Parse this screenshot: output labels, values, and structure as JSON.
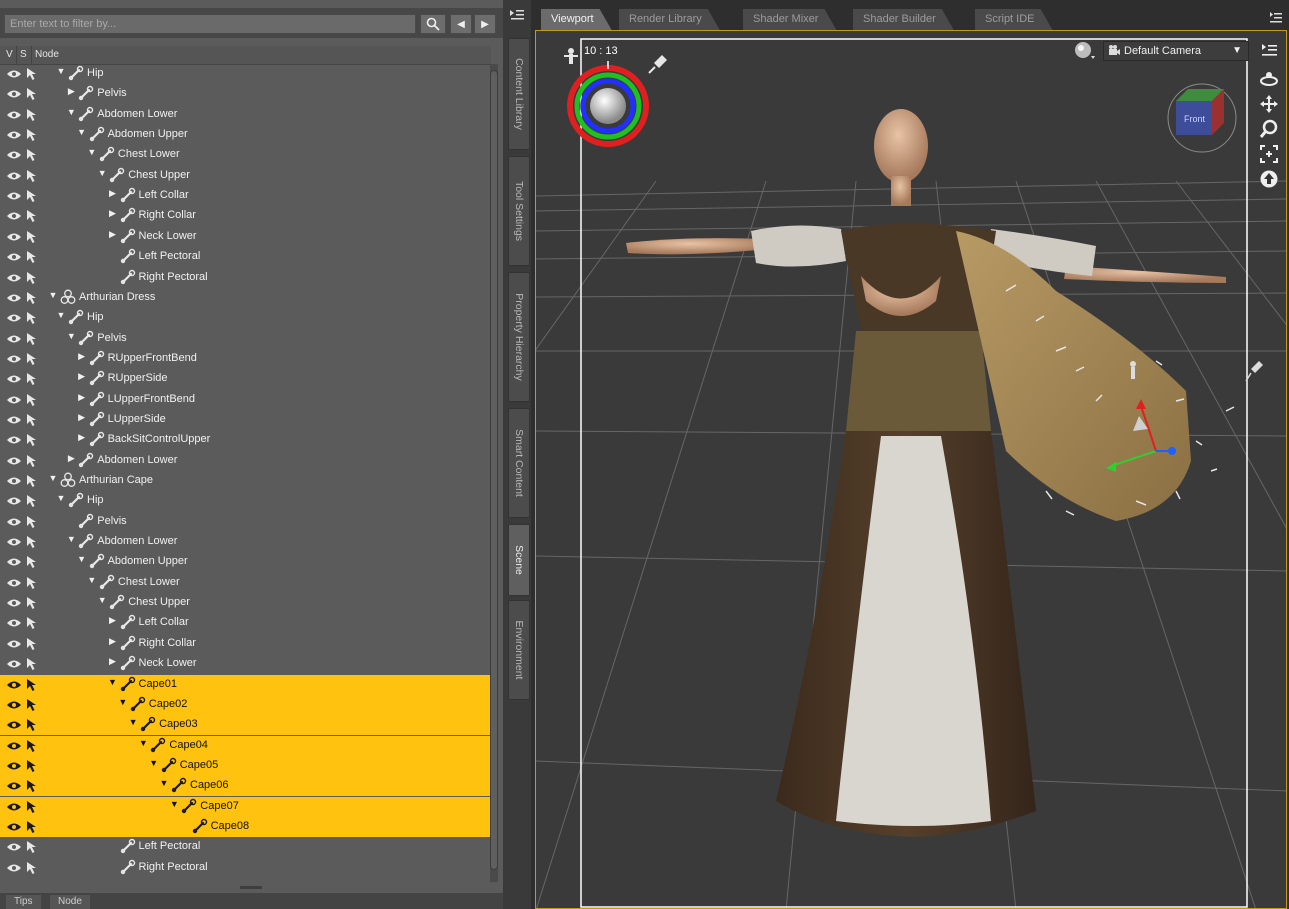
{
  "filter": {
    "placeholder": "Enter text to filter by..."
  },
  "tree_header": {
    "v": "V",
    "s": "S",
    "node": "Node"
  },
  "tree_rows": [
    {
      "label": "Hip",
      "indent": 0,
      "exp": "down",
      "icon": "bone",
      "selected": false
    },
    {
      "label": "Pelvis",
      "indent": 1,
      "exp": "right",
      "icon": "bone",
      "selected": false
    },
    {
      "label": "Abdomen Lower",
      "indent": 1,
      "exp": "down",
      "icon": "bone",
      "selected": false
    },
    {
      "label": "Abdomen Upper",
      "indent": 2,
      "exp": "down",
      "icon": "bone",
      "selected": false
    },
    {
      "label": "Chest Lower",
      "indent": 3,
      "exp": "down",
      "icon": "bone",
      "selected": false
    },
    {
      "label": "Chest Upper",
      "indent": 4,
      "exp": "down",
      "icon": "bone",
      "selected": false
    },
    {
      "label": "Left Collar",
      "indent": 5,
      "exp": "right",
      "icon": "bone",
      "selected": false
    },
    {
      "label": "Right Collar",
      "indent": 5,
      "exp": "right",
      "icon": "bone",
      "selected": false
    },
    {
      "label": "Neck Lower",
      "indent": 5,
      "exp": "right",
      "icon": "bone",
      "selected": false
    },
    {
      "label": "Left Pectoral",
      "indent": 5,
      "exp": "",
      "icon": "bone",
      "selected": false
    },
    {
      "label": "Right Pectoral",
      "indent": 5,
      "exp": "",
      "icon": "bone",
      "selected": false
    },
    {
      "label": "Arthurian Dress",
      "indent": -1,
      "exp": "down",
      "icon": "figure",
      "selected": false
    },
    {
      "label": "Hip",
      "indent": 0,
      "exp": "down",
      "icon": "bone",
      "selected": false
    },
    {
      "label": "Pelvis",
      "indent": 1,
      "exp": "down",
      "icon": "bone",
      "selected": false
    },
    {
      "label": "RUpperFrontBend",
      "indent": 2,
      "exp": "right",
      "icon": "bone",
      "selected": false
    },
    {
      "label": "RUpperSide",
      "indent": 2,
      "exp": "right",
      "icon": "bone",
      "selected": false
    },
    {
      "label": "LUpperFrontBend",
      "indent": 2,
      "exp": "right",
      "icon": "bone",
      "selected": false
    },
    {
      "label": "LUpperSide",
      "indent": 2,
      "exp": "right",
      "icon": "bone",
      "selected": false
    },
    {
      "label": "BackSitControlUpper",
      "indent": 2,
      "exp": "right",
      "icon": "bone",
      "selected": false
    },
    {
      "label": "Abdomen Lower",
      "indent": 1,
      "exp": "right",
      "icon": "bone",
      "selected": false
    },
    {
      "label": "Arthurian Cape",
      "indent": -1,
      "exp": "down",
      "icon": "figure",
      "selected": false
    },
    {
      "label": "Hip",
      "indent": 0,
      "exp": "down",
      "icon": "bone",
      "selected": false
    },
    {
      "label": "Pelvis",
      "indent": 1,
      "exp": "",
      "icon": "bone",
      "selected": false
    },
    {
      "label": "Abdomen Lower",
      "indent": 1,
      "exp": "down",
      "icon": "bone",
      "selected": false
    },
    {
      "label": "Abdomen Upper",
      "indent": 2,
      "exp": "down",
      "icon": "bone",
      "selected": false
    },
    {
      "label": "Chest Lower",
      "indent": 3,
      "exp": "down",
      "icon": "bone",
      "selected": false
    },
    {
      "label": "Chest Upper",
      "indent": 4,
      "exp": "down",
      "icon": "bone",
      "selected": false
    },
    {
      "label": "Left Collar",
      "indent": 5,
      "exp": "right",
      "icon": "bone",
      "selected": false
    },
    {
      "label": "Right Collar",
      "indent": 5,
      "exp": "right",
      "icon": "bone",
      "selected": false
    },
    {
      "label": "Neck Lower",
      "indent": 5,
      "exp": "right",
      "icon": "bone",
      "selected": false
    },
    {
      "label": "Cape01",
      "indent": 5,
      "exp": "down",
      "icon": "bone",
      "selected": true
    },
    {
      "label": "Cape02",
      "indent": 6,
      "exp": "down",
      "icon": "bone",
      "selected": true
    },
    {
      "label": "Cape03",
      "indent": 7,
      "exp": "down",
      "icon": "bone",
      "selected": true
    },
    {
      "label": "Cape04",
      "indent": 8,
      "exp": "down",
      "icon": "bone",
      "selected": true
    },
    {
      "label": "Cape05",
      "indent": 9,
      "exp": "down",
      "icon": "bone",
      "selected": true
    },
    {
      "label": "Cape06",
      "indent": 10,
      "exp": "down",
      "icon": "bone",
      "selected": true
    },
    {
      "label": "Cape07",
      "indent": 11,
      "exp": "down",
      "icon": "bone",
      "selected": true
    },
    {
      "label": "Cape08",
      "indent": 12,
      "exp": "",
      "icon": "bone",
      "selected": true
    },
    {
      "label": "Left Pectoral",
      "indent": 5,
      "exp": "",
      "icon": "bone",
      "selected": false
    },
    {
      "label": "Right Pectoral",
      "indent": 5,
      "exp": "",
      "icon": "bone",
      "selected": false
    }
  ],
  "bottom_tabs": [
    "Tips",
    "Node"
  ],
  "side_tabs": [
    {
      "label": "Content Library",
      "active": false
    },
    {
      "label": "Tool Settings",
      "active": false
    },
    {
      "label": "Property Hierarchy",
      "active": false
    },
    {
      "label": "Smart Content",
      "active": false
    },
    {
      "label": "Scene",
      "active": true
    },
    {
      "label": "Environment",
      "active": false
    }
  ],
  "viewport_tabs": [
    {
      "label": "Viewport",
      "active": true
    },
    {
      "label": "Render Library",
      "active": false
    },
    {
      "label": "Shader Mixer",
      "active": false
    },
    {
      "label": "Shader Builder",
      "active": false
    },
    {
      "label": "Script IDE",
      "active": false
    }
  ],
  "viewport": {
    "camera": "Default Camera",
    "clock": "10 : 13",
    "view_cube_label": "Front",
    "right_tools": [
      "orbit-icon",
      "pan-icon",
      "zoom-icon",
      "frame-icon",
      "home-icon"
    ]
  },
  "colors": {
    "selection": "#ffc20e",
    "panel_bg": "#5b5b5b",
    "viewport_bg": "#2e2e2e",
    "viewport_border": "#c59a10"
  }
}
